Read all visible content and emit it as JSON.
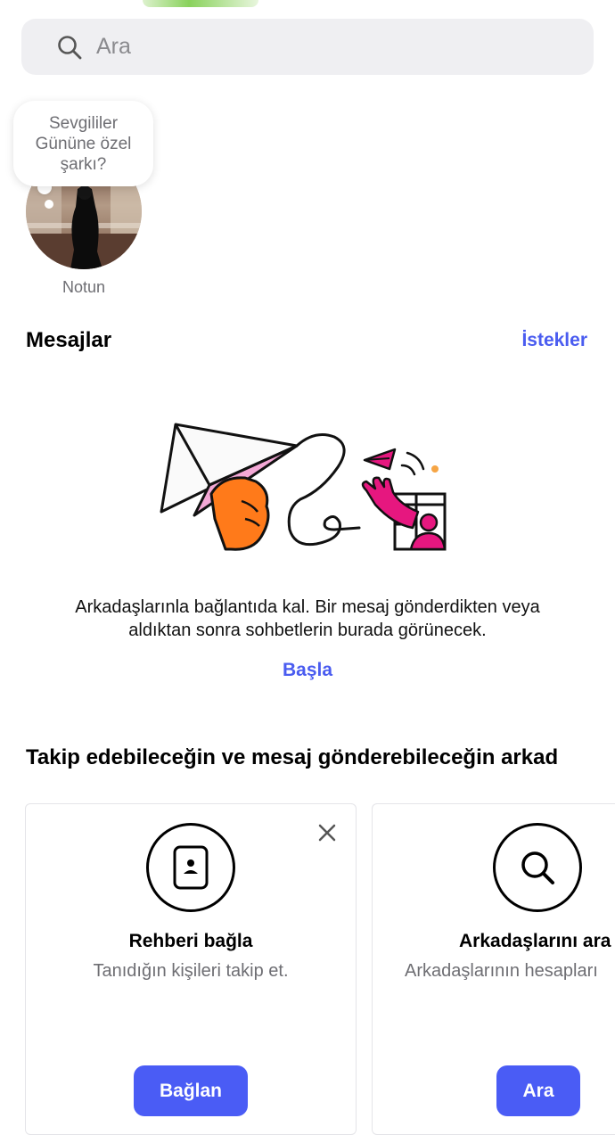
{
  "search": {
    "placeholder": "Ara"
  },
  "notes": {
    "bubble_text": "Sevgililer Gününe özel şarkı?",
    "own_label": "Notun"
  },
  "messages": {
    "title": "Mesajlar",
    "requests_link": "İstekler",
    "empty_text": "Arkadaşlarınla bağlantıda kal. Bir mesaj gönderdikten veya aldıktan sonra sohbetlerin burada görünecek.",
    "start_link": "Başla"
  },
  "suggestions": {
    "title": "Takip edebileceğin ve mesaj gönderebileceğin arkad",
    "cards": [
      {
        "icon": "contact-book-icon",
        "title": "Rehberi bağla",
        "subtitle": "Tanıdığın kişileri takip et.",
        "button": "Bağlan"
      },
      {
        "icon": "search-icon",
        "title": "Arkadaşlarını ara",
        "subtitle": "Arkadaşlarının hesapları",
        "button": "Ara"
      }
    ]
  },
  "colors": {
    "accent": "#4a5cf5",
    "link": "#4a5cf0",
    "search_bg": "#efeff2",
    "muted_text": "#6e6e73"
  }
}
